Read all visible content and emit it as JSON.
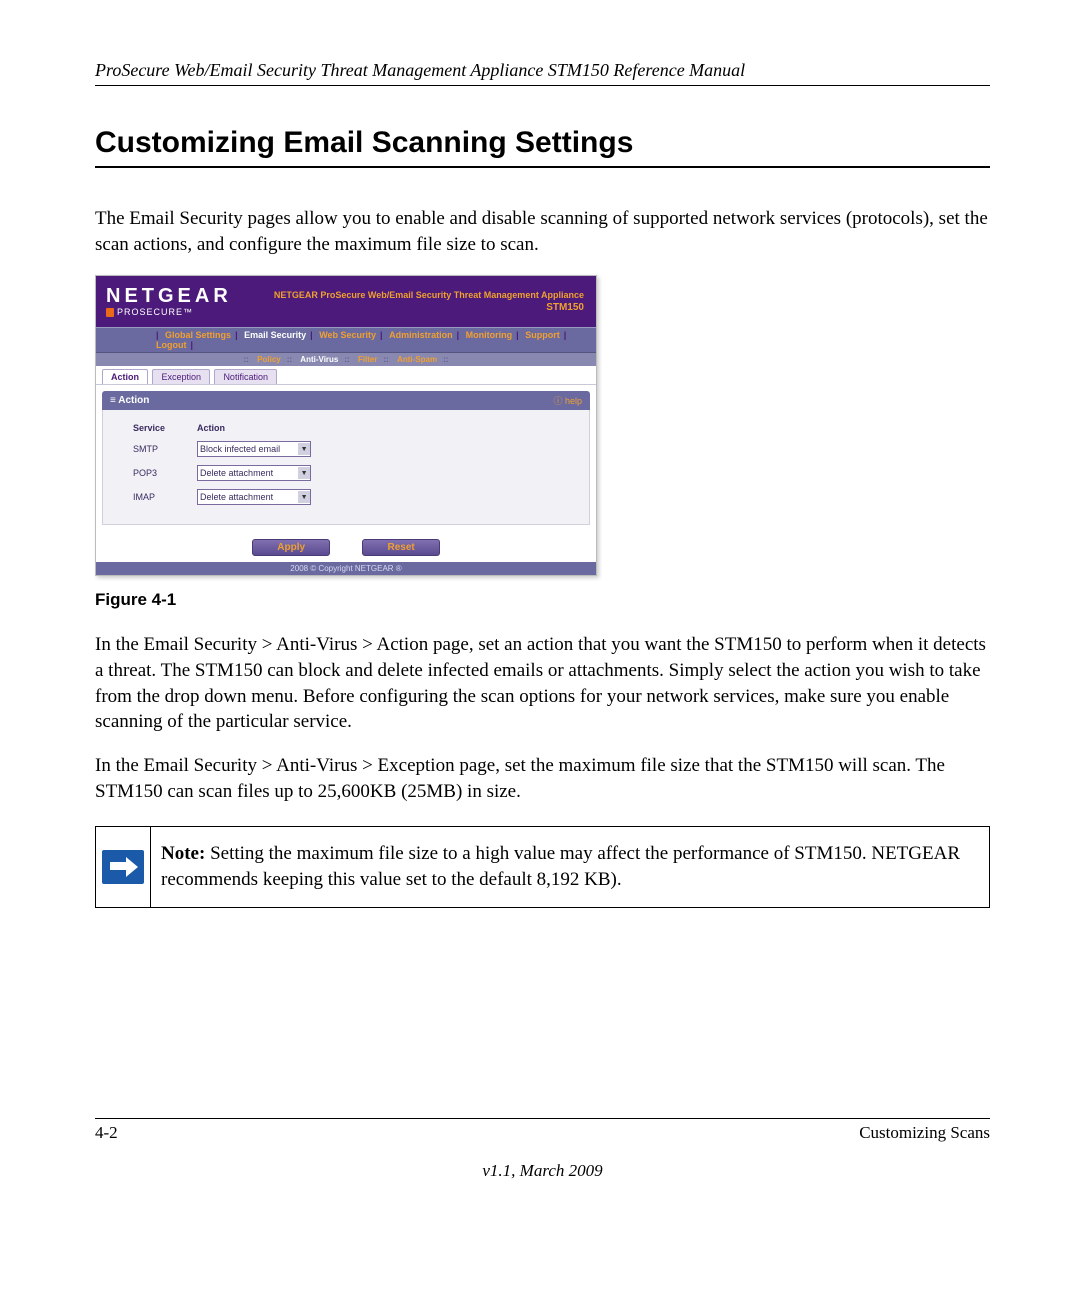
{
  "header": {
    "running": "ProSecure Web/Email Security Threat Management Appliance STM150 Reference Manual"
  },
  "title": "Customizing Email Scanning Settings",
  "para1": "The Email Security pages allow you to enable and disable scanning of supported network services (protocols), set the scan actions, and configure the maximum file size to scan.",
  "screenshot": {
    "brand": "NETGEAR",
    "brand_sub": "PROSECURE",
    "appliance_title": "NETGEAR ProSecure Web/Email Security Threat Management Appliance",
    "model": "STM150",
    "topnav": [
      "Global Settings",
      "Email Security",
      "Web Security",
      "Administration",
      "Monitoring",
      "Support",
      "Logout"
    ],
    "topnav_active_index": 1,
    "subnav": [
      "Policy",
      "Anti-Virus",
      "Filter",
      "Anti-Spam"
    ],
    "subnav_active_index": 1,
    "tabs": [
      "Action",
      "Exception",
      "Notification"
    ],
    "tabs_active_index": 0,
    "section_title": "Action",
    "help_label": "help",
    "col_headers": {
      "service": "Service",
      "action": "Action"
    },
    "rows": [
      {
        "service": "SMTP",
        "action": "Block infected email"
      },
      {
        "service": "POP3",
        "action": "Delete attachment"
      },
      {
        "service": "IMAP",
        "action": "Delete attachment"
      }
    ],
    "buttons": {
      "apply": "Apply",
      "reset": "Reset"
    },
    "copyright": "2008 © Copyright NETGEAR ®"
  },
  "figure_caption": "Figure 4-1",
  "para2": "In the Email Security > Anti-Virus > Action page, set an action that you want the STM150 to perform when it detects a threat. The STM150 can block and delete infected emails or attachments. Simply select the action you wish to take from the drop down menu. Before configuring the scan options for your network services, make sure you enable scanning of the particular service.",
  "para3": "In the Email Security > Anti-Virus > Exception page, set the maximum file size that the STM150 will scan. The STM150 can scan files up to 25,600KB (25MB) in size.",
  "note": {
    "label": "Note:",
    "text": " Setting the maximum file size to a high value may affect the performance of STM150. NETGEAR recommends keeping this value set to the default 8,192 KB)."
  },
  "footer": {
    "left": "4-2",
    "right": "Customizing Scans",
    "version": "v1.1, March 2009"
  }
}
